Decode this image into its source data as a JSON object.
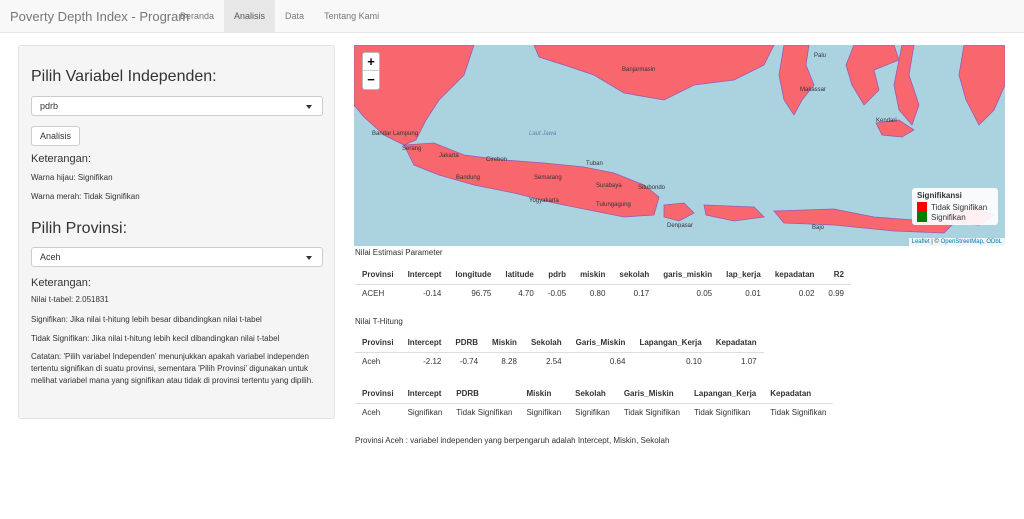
{
  "app": {
    "title": "Poverty Depth Index - Program",
    "nav": [
      "Beranda",
      "Analisis",
      "Data",
      "Tentang Kami"
    ],
    "active_tab": "Analisis"
  },
  "sidebar": {
    "var_heading": "Pilih Variabel Independen:",
    "var_selected": "pdrb",
    "analyze_label": "Analisis",
    "ket1_heading": "Keterangan:",
    "ket1_green": "Warna hijau: Signifikan",
    "ket1_red": "Warna merah: Tidak Signifikan",
    "prov_heading": "Pilih Provinsi:",
    "prov_selected": "Aceh",
    "ket2_heading": "Keterangan:",
    "t_table": "Nilai t-tabel: 2.051831",
    "sig_note": "Signifikan: Jika nilai t-hitung lebih besar dibandingkan nilai t-tabel",
    "notsig_note": "Tidak Signifikan: Jika nilai t-hitung lebih kecil dibandingkan nilai t-tabel",
    "catatan": "Catatan: 'Pilih variabel Independen' menunjukkan apakah variabel independen tertentu signifikan di suatu provinsi, sementara 'Pilih Provinsi' digunakan untuk melihat variabel mana yang signifikan atau tidak di provinsi tertentu yang dipilih."
  },
  "map": {
    "zoom_in": "+",
    "zoom_out": "−",
    "legend_title": "Signifikansi",
    "legend": [
      {
        "label": "Tidak Signifikan",
        "color": "#ff0000"
      },
      {
        "label": "Signifikan",
        "color": "#008000"
      }
    ],
    "attribution_leaflet": "Leaflet",
    "attribution_sep": " | © ",
    "attribution_osm": "OpenStreetMap",
    "attribution_odbl": "ODbL",
    "labels": [
      "Bandar Lampung",
      "Serang",
      "Jakarta",
      "Bandung",
      "Cirebon",
      "Semarang",
      "Yogyakarta",
      "Surabaya",
      "Tuban",
      "Situbondo",
      "Tulungagung",
      "Denpasar",
      "Banjarmasin",
      "Makassar",
      "Kendari",
      "Palu",
      "Bajo",
      "Laut Jawa"
    ],
    "region_color": "#f8676d"
  },
  "estimasi": {
    "title": "Nilai Estimasi Parameter",
    "headers": [
      "Provinsi",
      "Intercept",
      "longitude",
      "latitude",
      "pdrb",
      "miskin",
      "sekolah",
      "garis_miskin",
      "lap_kerja",
      "kepadatan",
      "R2"
    ],
    "rows": [
      [
        "ACEH",
        "-0.14",
        "96.75",
        "4.70",
        "-0.05",
        "0.80",
        "0.17",
        "0.05",
        "0.01",
        "0.02",
        "0.99"
      ]
    ]
  },
  "thitung": {
    "title": "Nilai T-Hitung",
    "headers": [
      "Provinsi",
      "Intercept",
      "PDRB",
      "Miskin",
      "Sekolah",
      "Garis_Miskin",
      "Lapangan_Kerja",
      "Kepadatan"
    ],
    "rows": [
      [
        "Aceh",
        "-2.12",
        "-0.74",
        "8.28",
        "2.54",
        "0.64",
        "0.10",
        "1.07"
      ]
    ]
  },
  "signif": {
    "headers": [
      "Provinsi",
      "Intercept",
      "PDRB",
      "Miskin",
      "Sekolah",
      "Garis_Miskin",
      "Lapangan_Kerja",
      "Kepadatan"
    ],
    "rows": [
      [
        "Aceh",
        "Signifikan",
        "Tidak Signifikan",
        "Signifikan",
        "Signifikan",
        "Tidak Signifikan",
        "Tidak Signifikan",
        "Tidak Signifikan"
      ]
    ]
  },
  "conclusion": "Provinsi Aceh : variabel independen yang berpengaruh adalah Intercept, Miskin, Sekolah"
}
